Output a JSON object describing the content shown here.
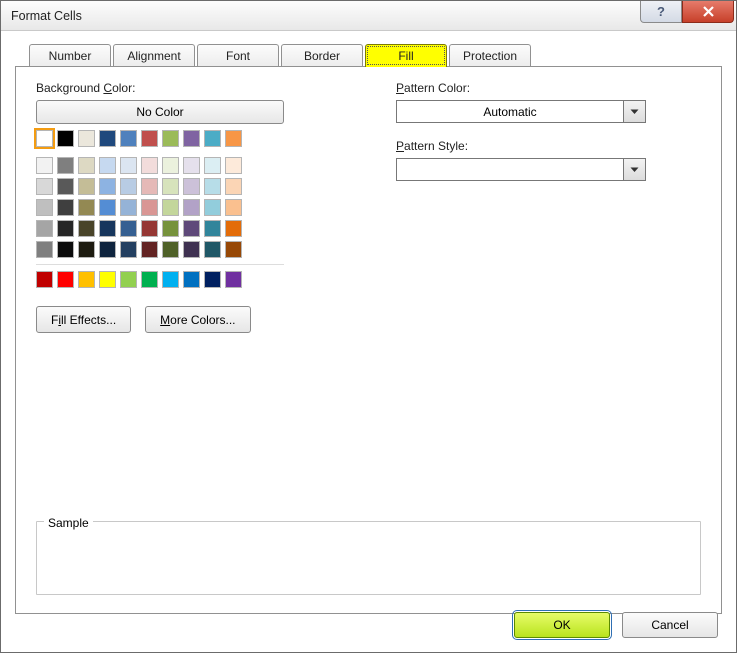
{
  "titlebar": {
    "title": "Format Cells"
  },
  "tabs": [
    {
      "label": "Number"
    },
    {
      "label": "Alignment"
    },
    {
      "label": "Font"
    },
    {
      "label": "Border"
    },
    {
      "label": "Fill",
      "active": true
    },
    {
      "label": "Protection"
    }
  ],
  "fill": {
    "bg_label": "Background Color:",
    "no_color": "No Color",
    "fill_effects": "Fill Effects...",
    "more_colors": "More Colors...",
    "pattern_color_label": "Pattern Color:",
    "pattern_color_value": "Automatic",
    "pattern_style_label": "Pattern Style:",
    "pattern_style_value": "",
    "sample_label": "Sample",
    "palette_row0": [
      "#ffffff",
      "#000000",
      "#ebe7dc",
      "#1f497d",
      "#4f81bd",
      "#c0504d",
      "#9bbb59",
      "#8064a2",
      "#4bacc6",
      "#f79646"
    ],
    "theme_rows": [
      [
        "#f2f2f2",
        "#7f7f7f",
        "#ddd9c3",
        "#c6d9f0",
        "#dbe5f1",
        "#f2dcdb",
        "#ebf1dd",
        "#e5e0ec",
        "#dbeef3",
        "#fdeada"
      ],
      [
        "#d8d8d8",
        "#595959",
        "#c4bd97",
        "#8db3e2",
        "#b8cce4",
        "#e5b9b7",
        "#d7e3bc",
        "#ccc1d9",
        "#b7dde8",
        "#fbd5b5"
      ],
      [
        "#bfbfbf",
        "#3f3f3f",
        "#938953",
        "#548dd4",
        "#95b3d7",
        "#d99694",
        "#c3d69b",
        "#b2a2c7",
        "#92cddc",
        "#fac08f"
      ],
      [
        "#a5a5a5",
        "#262626",
        "#494429",
        "#17365d",
        "#366092",
        "#953734",
        "#76923c",
        "#5f497a",
        "#31859b",
        "#e36c09"
      ],
      [
        "#7f7f7f",
        "#0c0c0c",
        "#1d1b10",
        "#0f243e",
        "#244061",
        "#632423",
        "#4f6128",
        "#3f3151",
        "#205867",
        "#974806"
      ]
    ],
    "standard_row": [
      "#c00000",
      "#ff0000",
      "#ffc000",
      "#ffff00",
      "#92d050",
      "#00b050",
      "#00b0f0",
      "#0070c0",
      "#002060",
      "#7030a0"
    ]
  },
  "buttons": {
    "ok": "OK",
    "cancel": "Cancel"
  }
}
